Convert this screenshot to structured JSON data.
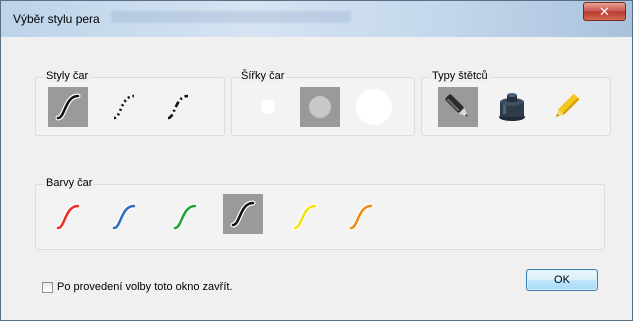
{
  "window": {
    "title": "Výběr stylu pera",
    "close_symbol": "✕"
  },
  "groups": {
    "line_styles": {
      "label": "Styly čar",
      "items": [
        {
          "icon": "solid-line-icon",
          "selected": true
        },
        {
          "icon": "dotted-line-icon",
          "selected": false
        },
        {
          "icon": "dash-dot-line-icon",
          "selected": false
        }
      ]
    },
    "line_widths": {
      "label": "Šířky čar",
      "items": [
        {
          "icon": "thin-width-icon",
          "selected": false
        },
        {
          "icon": "medium-width-icon",
          "selected": true
        },
        {
          "icon": "thick-width-icon",
          "selected": false
        }
      ]
    },
    "brush_types": {
      "label": "Typy štětců",
      "items": [
        {
          "icon": "pen-icon",
          "selected": true
        },
        {
          "icon": "ink-pot-icon",
          "selected": false
        },
        {
          "icon": "highlighter-icon",
          "selected": false
        }
      ]
    },
    "line_colors": {
      "label": "Barvy čar",
      "items": [
        {
          "icon": "red-line-icon",
          "color": "#e8312a",
          "selected": false
        },
        {
          "icon": "blue-line-icon",
          "color": "#2f6fbf",
          "selected": false
        },
        {
          "icon": "green-line-icon",
          "color": "#22a53a",
          "selected": false
        },
        {
          "icon": "black-line-icon",
          "color": "#111111",
          "selected": true
        },
        {
          "icon": "yellow-line-icon",
          "color": "#f4e20d",
          "selected": false
        },
        {
          "icon": "orange-line-icon",
          "color": "#f08a12",
          "selected": false
        }
      ]
    }
  },
  "footer": {
    "close_checkbox_label": "Po provedení volby toto okno zavřít.",
    "close_checkbox_checked": false,
    "ok_label": "OK"
  }
}
